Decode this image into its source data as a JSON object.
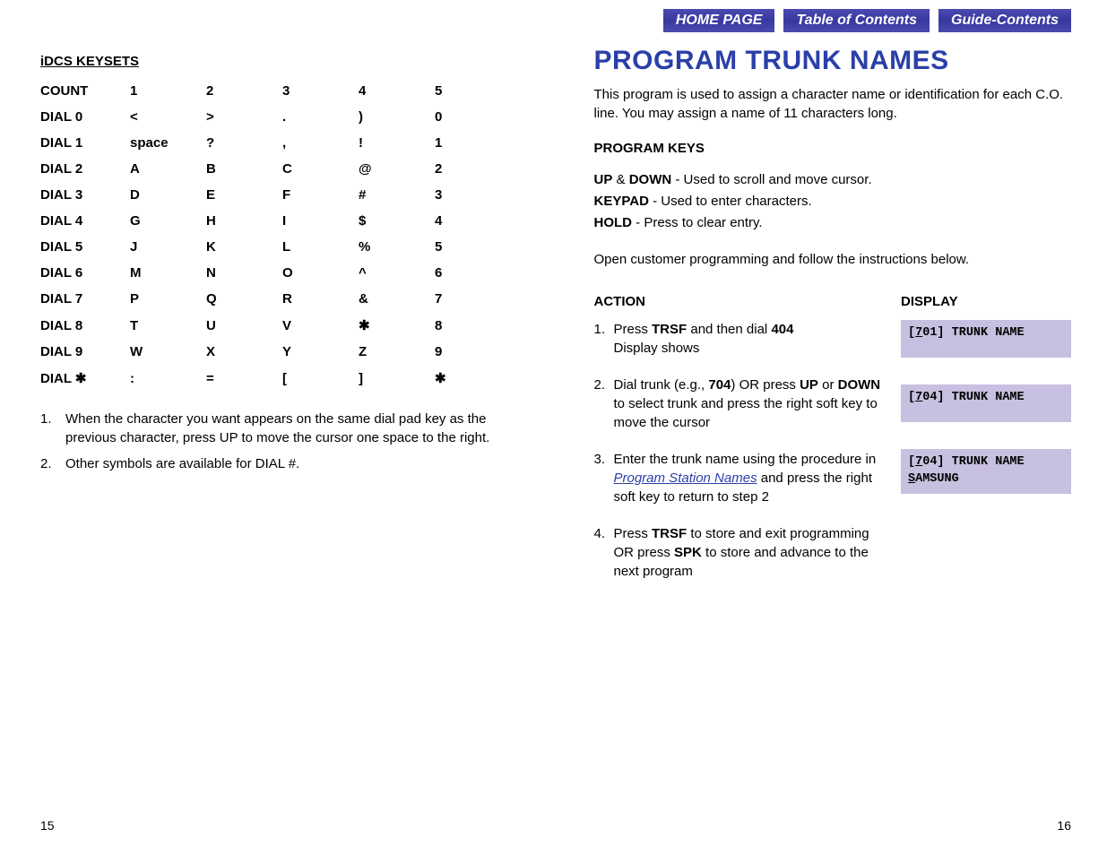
{
  "nav": {
    "home": "HOME PAGE",
    "toc": "Table of Contents",
    "guide": "Guide-Contents"
  },
  "left": {
    "section_title": "iDCS KEYSETS",
    "table": {
      "headers": [
        "COUNT",
        "1",
        "2",
        "3",
        "4",
        "5"
      ],
      "rows": [
        [
          "DIAL 0",
          "<",
          ">",
          ".",
          ")",
          "0"
        ],
        [
          "DIAL 1",
          "space",
          "?",
          ",",
          "!",
          "1"
        ],
        [
          "DIAL 2",
          "A",
          "B",
          "C",
          "@",
          "2"
        ],
        [
          "DIAL 3",
          "D",
          "E",
          "F",
          "#",
          "3"
        ],
        [
          "DIAL 4",
          "G",
          "H",
          "I",
          "$",
          "4"
        ],
        [
          "DIAL 5",
          "J",
          "K",
          "L",
          "%",
          "5"
        ],
        [
          "DIAL 6",
          "M",
          "N",
          "O",
          "^",
          "6"
        ],
        [
          "DIAL 7",
          "P",
          "Q",
          "R",
          "&",
          "7"
        ],
        [
          "DIAL 8",
          "T",
          "U",
          "V",
          "✱",
          "8"
        ],
        [
          "DIAL 9",
          "W",
          "X",
          "Y",
          "Z",
          "9"
        ],
        [
          "DIAL ✱",
          ":",
          "=",
          "[",
          "]",
          "✱"
        ]
      ]
    },
    "notes": [
      "When the character you want appears on the same dial pad key as the previous character, press UP to move the cursor one space to the right.",
      "Other symbols are available for DIAL #."
    ],
    "page_num": "15"
  },
  "right": {
    "heading": "PROGRAM TRUNK NAMES",
    "intro": "This program is used to assign a character name or identification for each C.O. line. You may assign a name of 11 characters long.",
    "program_keys_label": "PROGRAM KEYS",
    "keys": {
      "updown_label": "UP",
      "amp": " & ",
      "down_label": "DOWN",
      "updown_text": " - Used to scroll and move cursor.",
      "keypad_label": "KEYPAD",
      "keypad_text": " - Used to enter characters.",
      "hold_label": "HOLD",
      "hold_text": " - Press to clear entry."
    },
    "open_text": "Open customer programming and follow the instructions below.",
    "action_label": "ACTION",
    "display_label": "DISPLAY",
    "actions": {
      "a1_pre": "Press ",
      "a1_trsf": "TRSF",
      "a1_mid": " and then dial ",
      "a1_code": "404",
      "a1_post": "Display shows",
      "a2_pre": "Dial trunk (e.g., ",
      "a2_code": "704",
      "a2_mid": ") OR press ",
      "a2_up": "UP",
      "a2_or": " or ",
      "a2_down": "DOWN",
      "a2_post": " to select trunk and press the right soft key to move the cursor",
      "a3_pre": "Enter the trunk name using the procedure in ",
      "a3_link": "Program Station Names",
      "a3_post": " and press the right soft key to return to step 2",
      "a4_pre": "Press ",
      "a4_trsf": "TRSF",
      "a4_mid": " to store and exit programming OR press ",
      "a4_spk": "SPK",
      "a4_post": " to store and advance to the next program"
    },
    "displays": {
      "d1": "[701] TRUNK NAME\n ",
      "d2": "[704] TRUNK NAME\n ",
      "d3": "[704] TRUNK NAME\nSAMSUNG"
    },
    "page_num": "16"
  }
}
